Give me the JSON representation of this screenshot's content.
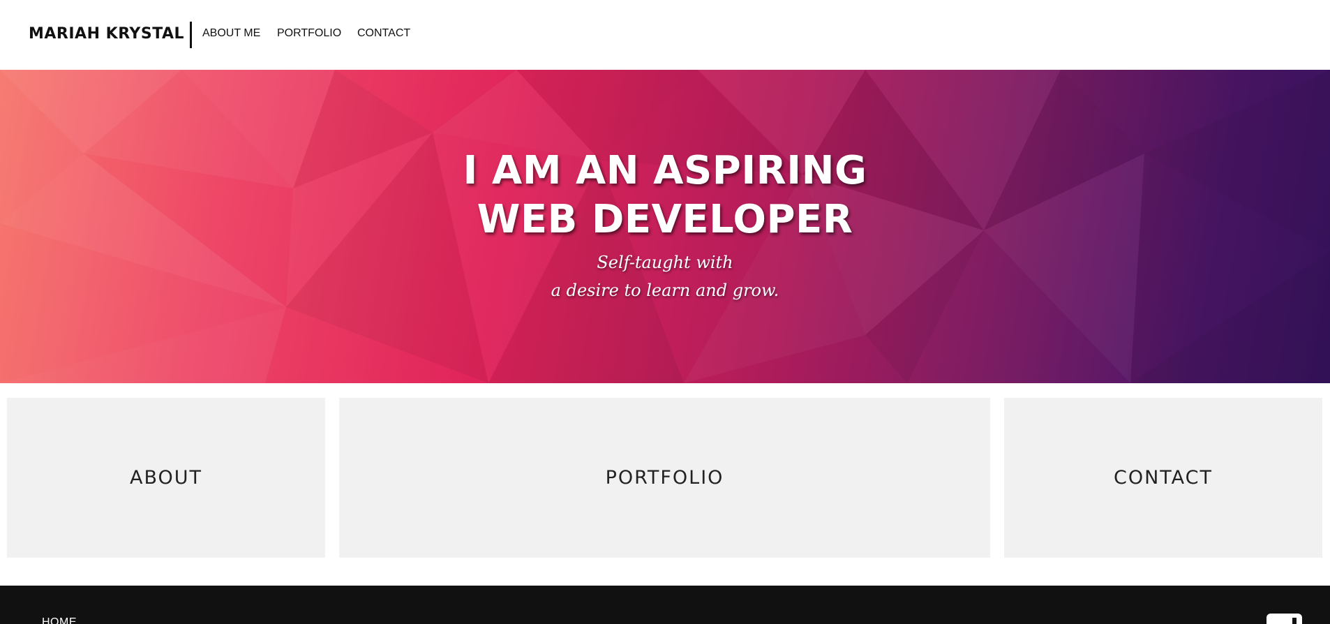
{
  "header": {
    "brand": "MARIAH KRYSTAL",
    "nav": [
      {
        "label": "ABOUT ME"
      },
      {
        "label": "PORTFOLIO"
      },
      {
        "label": "CONTACT"
      }
    ]
  },
  "hero": {
    "title_line1": "I AM AN ASPIRING",
    "title_line2": "WEB DEVELOPER",
    "subtitle_line1": "Self-taught with",
    "subtitle_line2": "a desire to learn and grow."
  },
  "cards": [
    {
      "label": "ABOUT"
    },
    {
      "label": "PORTFOLIO"
    },
    {
      "label": "CONTACT"
    }
  ],
  "footer": {
    "home_label": "HOME",
    "social_icon": "square-social-icon"
  },
  "colors": {
    "hero_gradient_start": "#f6746a",
    "hero_gradient_mid": "#e0245a",
    "hero_gradient_end": "#3a1463",
    "card_bg": "#f1f1f1",
    "footer_bg": "#111111"
  }
}
